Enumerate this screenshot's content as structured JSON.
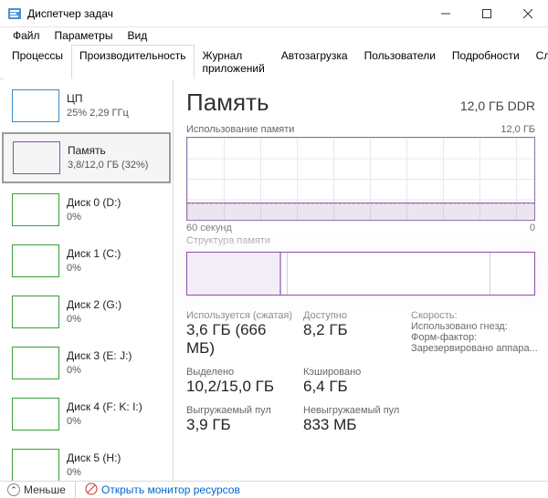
{
  "window": {
    "title": "Диспетчер задач"
  },
  "menu": {
    "file": "Файл",
    "options": "Параметры",
    "view": "Вид"
  },
  "tabs": {
    "processes": "Процессы",
    "performance": "Производительность",
    "history": "Журнал приложений",
    "startup": "Автозагрузка",
    "users": "Пользователи",
    "details": "Подробности",
    "services": "Службы"
  },
  "sidebar": [
    {
      "name": "ЦП",
      "sub": "25% 2,29 ГГц",
      "color": "#3b88c4"
    },
    {
      "name": "Память",
      "sub": "3,8/12,0 ГБ (32%)",
      "color": "#8b4fa8",
      "selected": true
    },
    {
      "name": "Диск 0 (D:)",
      "sub": "0%",
      "color": "#3a9e3a"
    },
    {
      "name": "Диск 1 (C:)",
      "sub": "0%",
      "color": "#3a9e3a"
    },
    {
      "name": "Диск 2 (G:)",
      "sub": "0%",
      "color": "#3a9e3a"
    },
    {
      "name": "Диск 3 (E: J:)",
      "sub": "0%",
      "color": "#3a9e3a"
    },
    {
      "name": "Диск 4 (F: K: I:)",
      "sub": "0%",
      "color": "#3a9e3a"
    },
    {
      "name": "Диск 5 (H:)",
      "sub": "0%",
      "color": "#3a9e3a"
    }
  ],
  "main": {
    "title": "Память",
    "spec": "12,0 ГБ DDR",
    "usage_label": "Использование памяти",
    "usage_max": "12,0 ГБ",
    "x_start": "60 секунд",
    "x_end": "0",
    "struct_label": "Структура памяти",
    "stats": {
      "used_lbl": "Используется (сжатая)",
      "used": "3,6 ГБ (666 МБ)",
      "avail_lbl": "Доступно",
      "avail": "8,2 ГБ",
      "commit_lbl": "Выделено",
      "commit": "10,2/15,0 ГБ",
      "cached_lbl": "Кэшировано",
      "cached": "6,4 ГБ",
      "paged_lbl": "Выгружаемый пул",
      "paged": "3,9 ГБ",
      "nonpaged_lbl": "Невыгружаемый пул",
      "nonpaged": "833 МБ",
      "speed_lbl": "Скорость:",
      "slots_lbl": "Использовано гнезд:",
      "form_lbl": "Форм-фактор:",
      "reserved_lbl": "Зарезервировано аппара..."
    }
  },
  "footer": {
    "less": "Меньше",
    "link": "Открыть монитор ресурсов"
  },
  "chart_data": {
    "type": "line",
    "title": "Использование памяти",
    "ylabel": "",
    "ylim": [
      0,
      12
    ],
    "y_unit": "ГБ",
    "x_range_seconds": 60,
    "series": [
      {
        "name": "Память",
        "approx_constant_value": 3.8
      }
    ]
  }
}
